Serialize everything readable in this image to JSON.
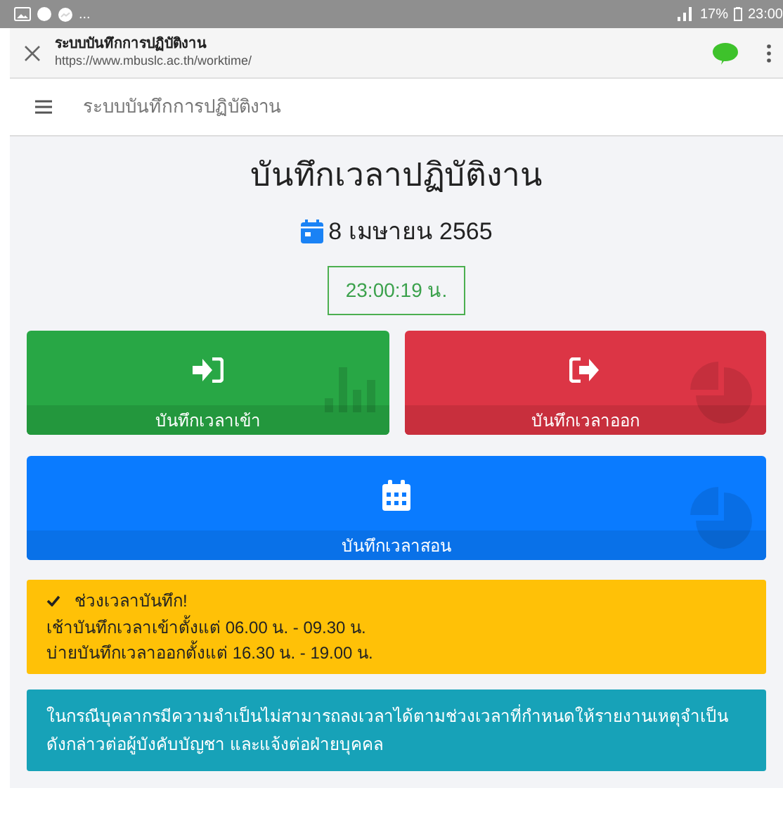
{
  "status_bar": {
    "more": "...",
    "battery": "17%",
    "time": "23:00"
  },
  "browser": {
    "title": "ระบบบันทึกการปฏิบัติงาน",
    "url": "https://www.mbuslc.ac.th/worktime/"
  },
  "navbar": {
    "title": "ระบบบันทึกการปฏิบัติงาน"
  },
  "heading": "บันทึกเวลาปฏิบัติงาน",
  "date": "8 เมษายน 2565",
  "clock": "23:00:19 น.",
  "actions": [
    {
      "label": "บันทึกเวลาเข้า",
      "kind": "check-in"
    },
    {
      "label": "บันทึกเวลาออก",
      "kind": "check-out"
    },
    {
      "label": "บันทึกเวลาสอน",
      "kind": "teaching"
    }
  ],
  "notice": {
    "title": "ช่วงเวลาบันทึก!",
    "lines": [
      "เช้าบันทึกเวลาเข้าตั้งแต่ 06.00 น. - 09.30 น.",
      "บ่ายบันทึกเวลาออกตั้งแต่ 16.30 น. - 19.00 น."
    ]
  },
  "info": "ในกรณีบุคลากรมีความจำเป็นไม่สามารถลงเวลาได้ตามช่วงเวลาที่กำหนดให้รายงานเหตุจำเป็นดังกล่าวต่อผู้บังคับบัญชา และแจ้งต่อฝ่ายบุคคล"
}
